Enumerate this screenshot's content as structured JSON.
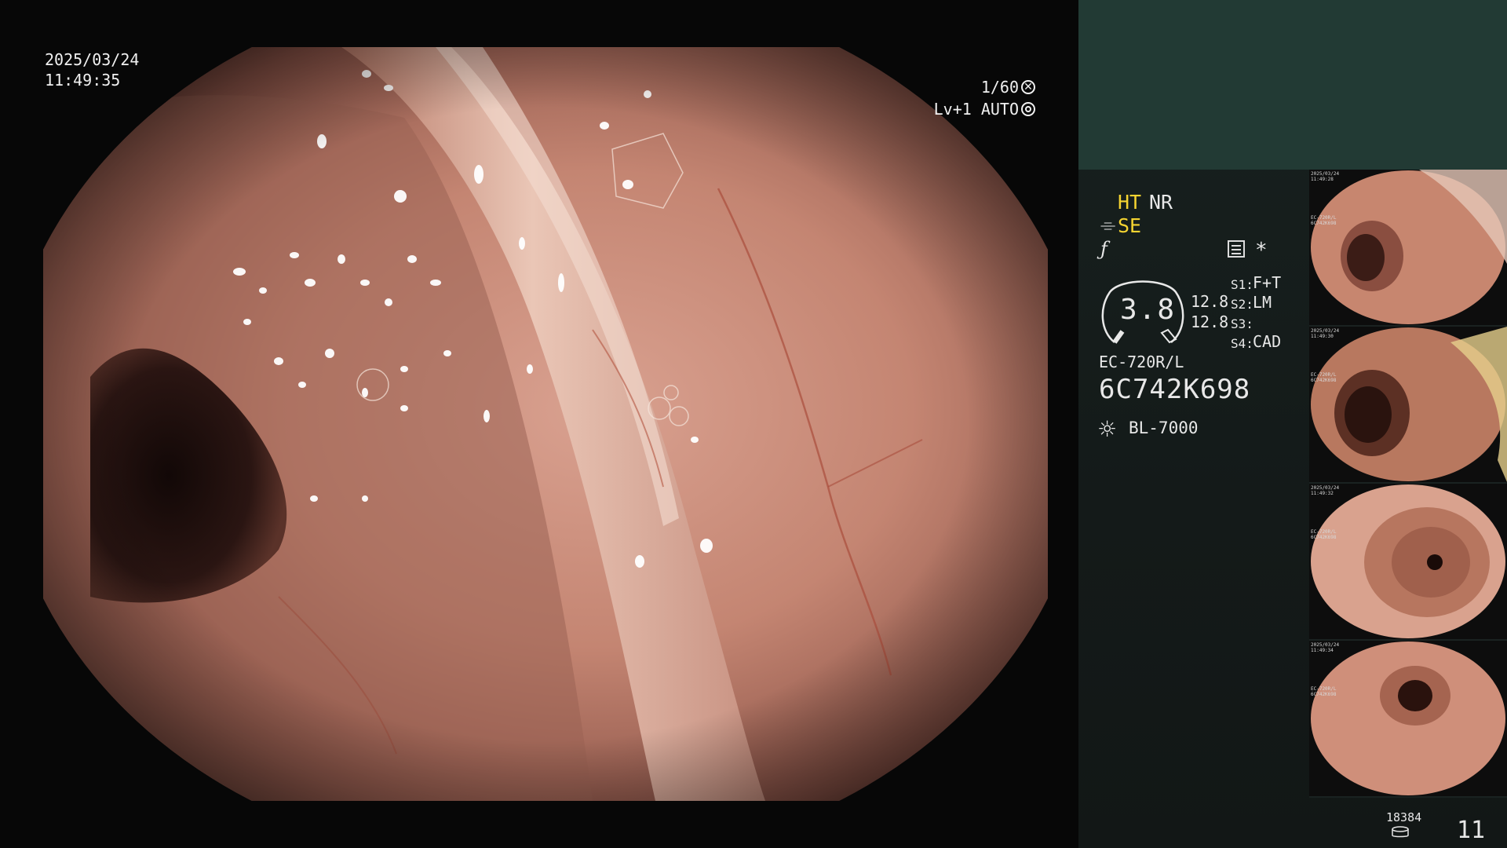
{
  "osd": {
    "date": "2025/03/24",
    "time": "11:49:35",
    "shutter": "1/60",
    "level": "Lv+1",
    "iris": "AUTO"
  },
  "panel": {
    "modes": {
      "ht": "HT",
      "nr": "NR",
      "se": "SE",
      "se_icon": "⌯",
      "f_icon": "ƒ"
    },
    "asterisk": "*",
    "zoom_value": "3.8",
    "values": [
      "12.8",
      "12.8"
    ],
    "slots": [
      {
        "label": "S1:",
        "value": "F+T"
      },
      {
        "label": "S2:",
        "value": "LM"
      },
      {
        "label": "S3:",
        "value": ""
      },
      {
        "label": "S4:",
        "value": "CAD"
      }
    ],
    "scope_model": "EC-720R/L",
    "scope_serial": "6C742K698",
    "light_icon": "☼",
    "light_source": "BL-7000"
  },
  "thumbnails": [
    {
      "name": "thumbnail-1",
      "caption": "2025/03/24\n11:49:28\n\n\n\n\n\n\nEC-720R/L\n6C742K698"
    },
    {
      "name": "thumbnail-2",
      "caption": "2025/03/24\n11:49:30\n\n\n\n\n\n\nEC-720R/L\n6C742K698"
    },
    {
      "name": "thumbnail-3",
      "caption": "2025/03/24\n11:49:32\n\n\n\n\n\n\nEC-720R/L\n6C742K698"
    },
    {
      "name": "thumbnail-4",
      "caption": "2025/03/24\n11:49:34\n\n\n\n\n\n\nEC-720R/L\n6C742K698"
    }
  ],
  "footer": {
    "storage_count": "18384",
    "image_count": "11"
  },
  "colors": {
    "mode_active": "#f5d431",
    "panel_top": "#223a34",
    "tissue": "#c98876"
  }
}
